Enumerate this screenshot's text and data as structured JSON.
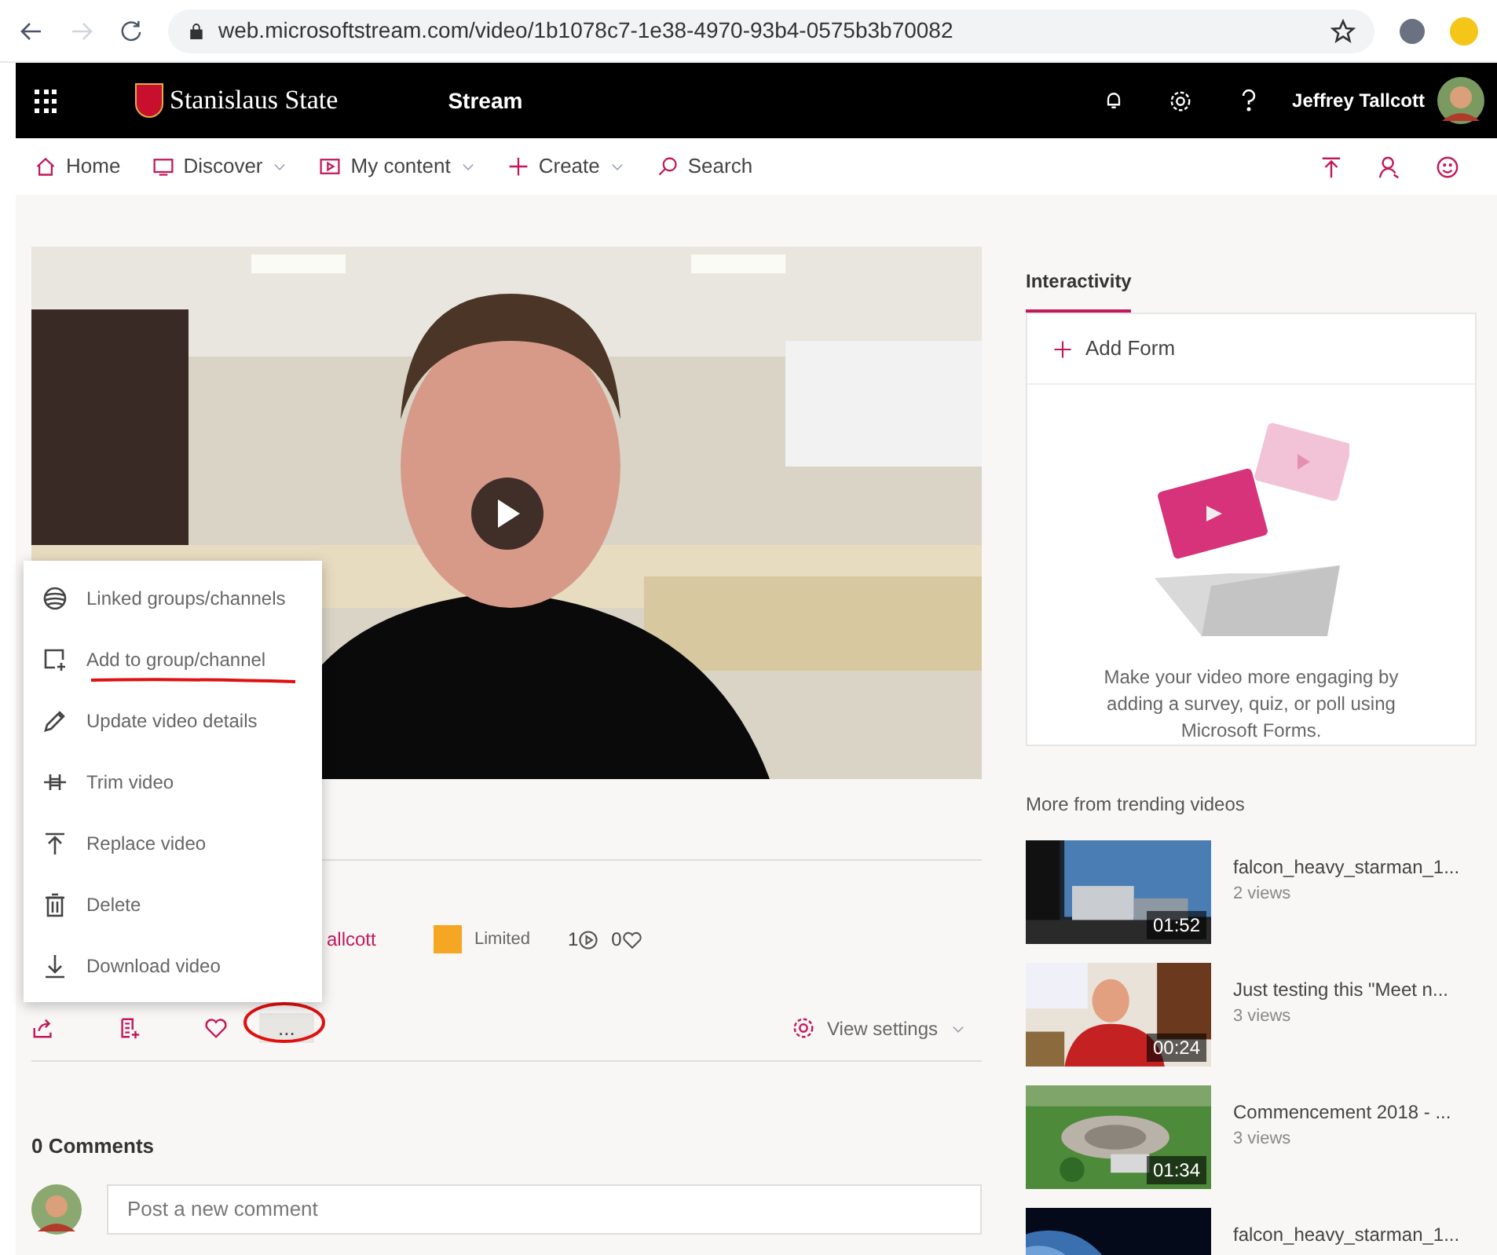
{
  "browser": {
    "url": "web.microsoftstream.com/video/1b1078c7-1e38-4970-93b4-0575b3b70082"
  },
  "header": {
    "brand": "Stanislaus State",
    "app": "Stream",
    "user": "Jeffrey Tallcott"
  },
  "nav": [
    {
      "label": "Home",
      "kind": "home",
      "dropdown": false
    },
    {
      "label": "Discover",
      "kind": "discover",
      "dropdown": true
    },
    {
      "label": "My content",
      "kind": "content",
      "dropdown": true
    },
    {
      "label": "Create",
      "kind": "create",
      "dropdown": true
    },
    {
      "label": "Search",
      "kind": "search",
      "dropdown": false
    }
  ],
  "menu": [
    {
      "label": "Linked groups/channels",
      "kind": "linked",
      "annotated": false
    },
    {
      "label": "Add to group/channel",
      "kind": "add",
      "annotated": true
    },
    {
      "label": "Update video details",
      "kind": "edit",
      "annotated": false
    },
    {
      "label": "Trim video",
      "kind": "trim",
      "annotated": false
    },
    {
      "label": "Replace video",
      "kind": "replace",
      "annotated": false
    },
    {
      "label": "Delete",
      "kind": "delete",
      "annotated": false
    },
    {
      "label": "Download video",
      "kind": "download",
      "annotated": false
    }
  ],
  "details": {
    "owner": "allcott",
    "permission": "Limited",
    "plays": "1",
    "likes": "0"
  },
  "actions": {
    "more": "...",
    "more_annotated": true,
    "view_settings": "View settings"
  },
  "comments": {
    "title": "0 Comments",
    "placeholder": "Post a new comment"
  },
  "interactivity": {
    "tab": "Interactivity",
    "add_form": "Add Form",
    "message": "Make your video more engaging by adding a survey, quiz, or poll using Microsoft Forms."
  },
  "trending": {
    "title": "More from trending videos",
    "items": [
      {
        "title": "falcon_heavy_starman_1...",
        "views": "2 views",
        "duration": "01:52"
      },
      {
        "title": "Just testing this \"Meet n...",
        "views": "3 views",
        "duration": "00:24"
      },
      {
        "title": "Commencement 2018 - ...",
        "views": "3 views",
        "duration": "01:34"
      },
      {
        "title": "falcon_heavy_starman_1..."
      }
    ]
  }
}
